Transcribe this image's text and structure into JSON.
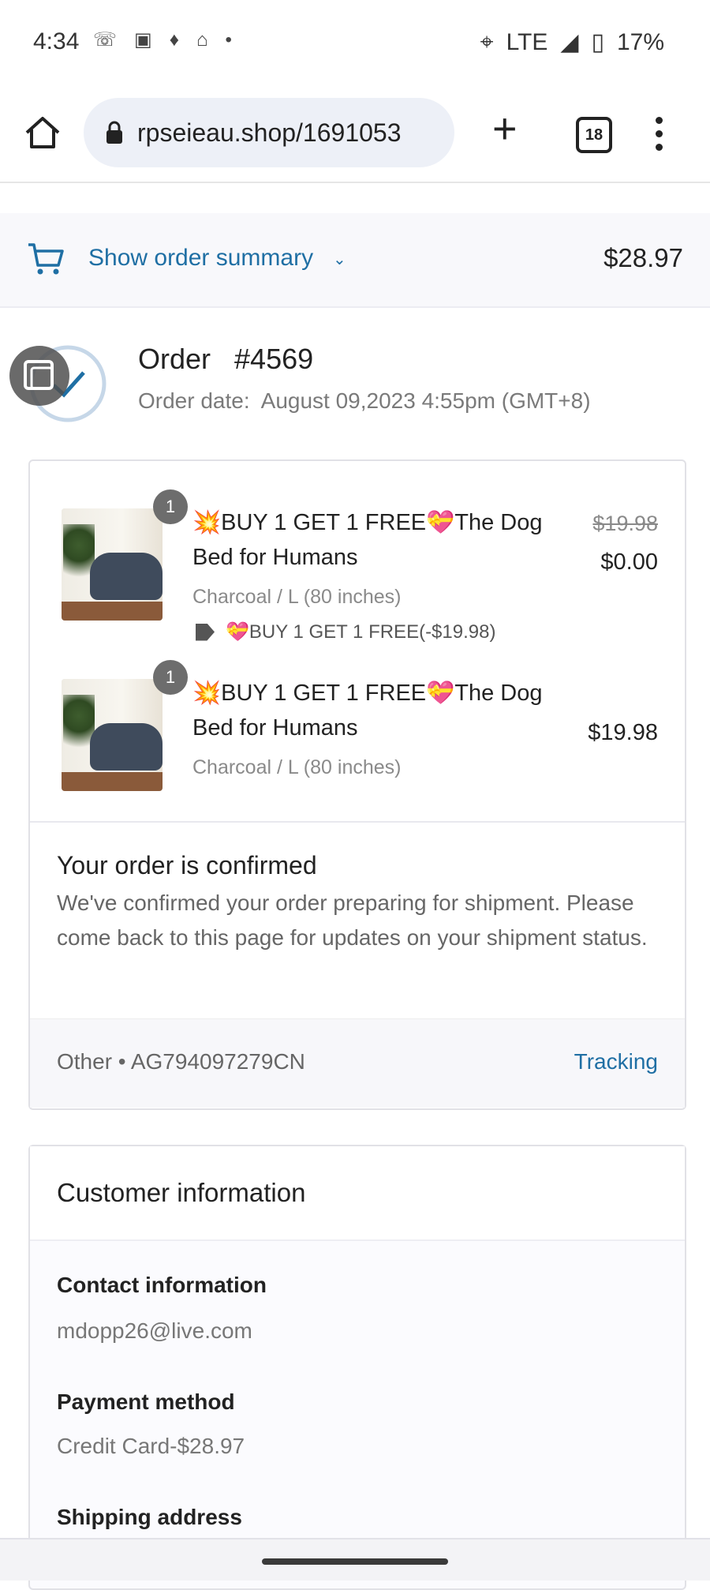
{
  "status_bar": {
    "time": "4:34",
    "network": "LTE",
    "battery": "17%"
  },
  "browser": {
    "url": "rpseieau.shop/1691053",
    "tab_count": "18"
  },
  "summary": {
    "label": "Show order summary",
    "total": "$28.97"
  },
  "order": {
    "title": "Order   #4569",
    "date": "Order date:  August 09,2023 4:55pm (GMT+8)"
  },
  "items": [
    {
      "quantity": "1",
      "title": "💥BUY 1 GET 1 FREE💝The Dog Bed for Humans",
      "variant": "Charcoal / L (80 inches)",
      "discount": "💝BUY 1 GET 1 FREE(-$19.98)",
      "compare_price": "$19.98",
      "price": "$0.00"
    },
    {
      "quantity": "1",
      "title": "💥BUY 1 GET 1 FREE💝The Dog Bed for Humans",
      "variant": "Charcoal / L (80 inches)",
      "price": "$19.98"
    }
  ],
  "confirmation": {
    "title": "Your order is confirmed",
    "text": "We've confirmed your order preparing for shipment. Please come back to this page for updates on your shipment status.",
    "carrier": "Other • AG794097279CN",
    "tracking_label": "Tracking"
  },
  "customer": {
    "title": "Customer information",
    "contact_label": "Contact information",
    "contact_value": "mdopp26@live.com",
    "payment_label": "Payment method",
    "payment_value": "Credit Card-$28.97",
    "shipping_label": "Shipping address"
  },
  "colors": {
    "link": "#1f6fa4",
    "summary_bg": "#f8f8fb"
  }
}
